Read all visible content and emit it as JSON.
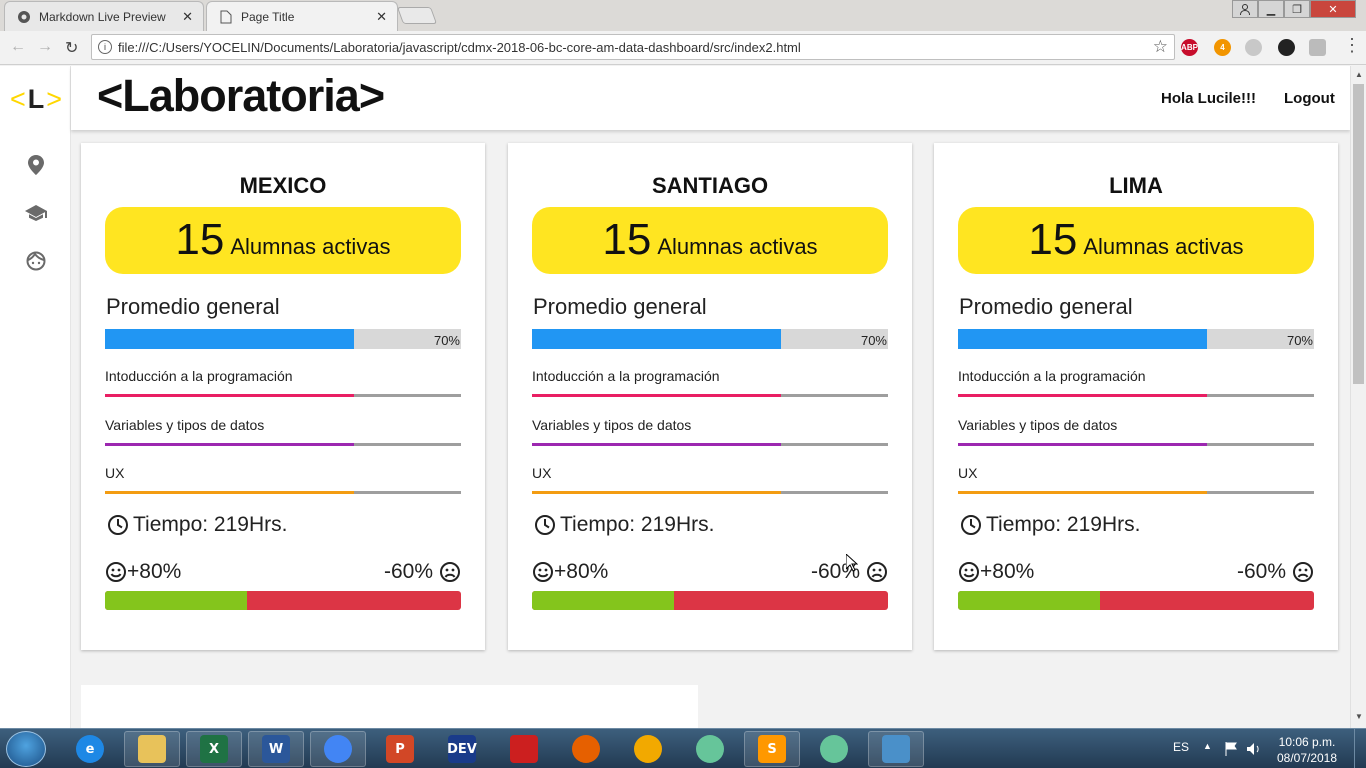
{
  "browser": {
    "tabs": [
      {
        "title": "Markdown Live Preview",
        "active": false
      },
      {
        "title": "Page Title",
        "active": true
      }
    ],
    "url": "file:///C:/Users/YOCELIN/Documents/Laboratoria/javascript/cdmx-2018-06-bc-core-am-data-dashboard/src/index2.html",
    "extensions": [
      {
        "name": "adblock-plus-icon",
        "label": "ABP",
        "color": "#c70d2c"
      },
      {
        "name": "extension-badge-icon",
        "label": "4",
        "color": "#f29500"
      }
    ]
  },
  "sidebar": {
    "logo": {
      "left": "<",
      "letter": "L",
      "right": ">"
    },
    "icons": [
      "location-pin-icon",
      "graduation-cap-icon",
      "student-face-icon"
    ]
  },
  "header": {
    "brand": "<Laboratoria>",
    "greeting": "Hola Lucile!!!",
    "logout": "Logout"
  },
  "cards": [
    {
      "city": "MEXICO",
      "active_count": "15",
      "active_label": "Alumnas activas",
      "average_label": "Promedio general",
      "average_pct": 70,
      "average_text": "70%",
      "skills": [
        {
          "label": "Intoducción a la programación",
          "pct": 70,
          "color": "#e91e63"
        },
        {
          "label": "Variables y tipos de datos",
          "pct": 70,
          "color": "#9c27b0"
        },
        {
          "label": "UX",
          "pct": 70,
          "color": "#f39c12"
        }
      ],
      "time_label": "Tiempo: 219Hrs.",
      "positive_text": "+80%",
      "negative_text": "-60%",
      "split_good": 40
    },
    {
      "city": "SANTIAGO",
      "active_count": "15",
      "active_label": "Alumnas activas",
      "average_label": "Promedio general",
      "average_pct": 70,
      "average_text": "70%",
      "skills": [
        {
          "label": "Intoducción a la programación",
          "pct": 70,
          "color": "#e91e63"
        },
        {
          "label": "Variables y tipos de datos",
          "pct": 70,
          "color": "#9c27b0"
        },
        {
          "label": "UX",
          "pct": 70,
          "color": "#f39c12"
        }
      ],
      "time_label": "Tiempo: 219Hrs.",
      "positive_text": "+80%",
      "negative_text": "-60%",
      "split_good": 40
    },
    {
      "city": "LIMA",
      "active_count": "15",
      "active_label": "Alumnas activas",
      "average_label": "Promedio general",
      "average_pct": 70,
      "average_text": "70%",
      "skills": [
        {
          "label": "Intoducción a la programación",
          "pct": 70,
          "color": "#e91e63"
        },
        {
          "label": "Variables y tipos de datos",
          "pct": 70,
          "color": "#9c27b0"
        },
        {
          "label": "UX",
          "pct": 70,
          "color": "#f39c12"
        }
      ],
      "time_label": "Tiempo: 219Hrs.",
      "positive_text": "+80%",
      "negative_text": "-60%",
      "split_good": 40
    }
  ],
  "colors": {
    "accent_yellow": "#ffe521",
    "average_bar": "#2196f3",
    "positive": "#84c51c",
    "negative": "#dc3545"
  },
  "taskbar": {
    "apps": [
      {
        "name": "internet-explorer-icon",
        "label": "e",
        "color": "#1e88e5"
      },
      {
        "name": "file-explorer-icon",
        "label": "",
        "color": "#e8c25a"
      },
      {
        "name": "excel-icon",
        "label": "X",
        "color": "#1f7244"
      },
      {
        "name": "word-icon",
        "label": "W",
        "color": "#2b579a"
      },
      {
        "name": "chrome-icon",
        "label": "",
        "color": "#4285f4"
      },
      {
        "name": "powerpoint-icon",
        "label": "P",
        "color": "#d24726"
      },
      {
        "name": "devcpp-icon",
        "label": "DEV",
        "color": "#1a3b8a"
      },
      {
        "name": "acrobat-icon",
        "label": "",
        "color": "#cc1f1f"
      },
      {
        "name": "firefox-icon",
        "label": "",
        "color": "#e66000"
      },
      {
        "name": "chromium-icon",
        "label": "",
        "color": "#f2a900"
      },
      {
        "name": "atom-icon",
        "label": "",
        "color": "#66c59a"
      },
      {
        "name": "sublime-icon",
        "label": "S",
        "color": "#ff9800"
      },
      {
        "name": "atom-2-icon",
        "label": "",
        "color": "#66c59a"
      },
      {
        "name": "image-viewer-icon",
        "label": "",
        "color": "#4a90c9"
      }
    ],
    "language": "ES",
    "time": "10:06 p.m.",
    "date": "08/07/2018"
  }
}
